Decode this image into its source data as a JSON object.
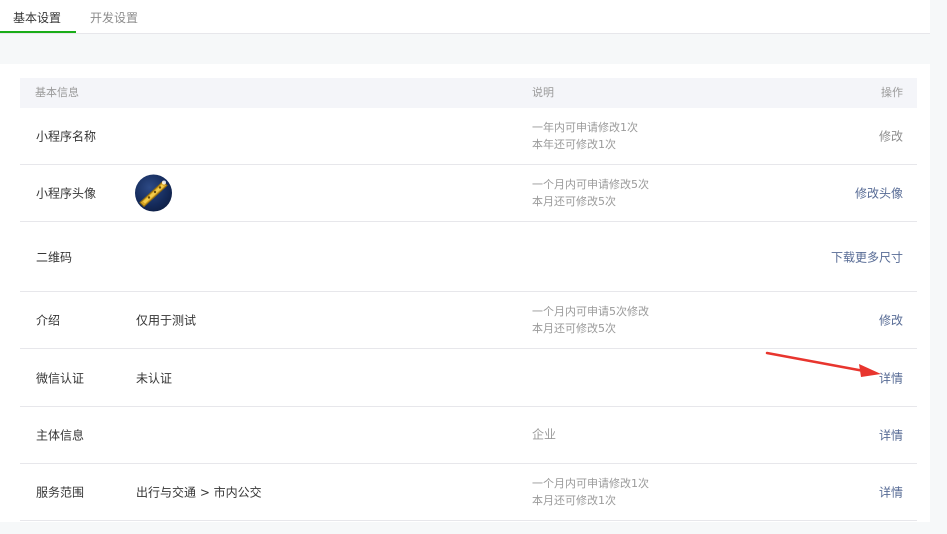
{
  "tabs": [
    {
      "label": "基本设置",
      "active": true
    },
    {
      "label": "开发设置",
      "active": false
    }
  ],
  "table": {
    "headers": {
      "info": "基本信息",
      "desc": "说明",
      "op": "操作"
    },
    "rows": [
      {
        "name": "小程序名称",
        "value": "",
        "desc": [
          "一年内可申请修改1次",
          "本年还可修改1次"
        ],
        "op": "修改"
      },
      {
        "name": "小程序头像",
        "value": "",
        "desc": [
          "一个月内可申请修改5次",
          "本月还可修改5次"
        ],
        "op": "修改头像"
      },
      {
        "name": "二维码",
        "value": "",
        "desc": [],
        "op": "下载更多尺寸"
      },
      {
        "name": "介绍",
        "value": "仅用于测试",
        "desc": [
          "一个月内可申请5次修改",
          "本月还可修改5次"
        ],
        "op": "修改"
      },
      {
        "name": "微信认证",
        "value": "未认证",
        "desc": [],
        "op": "详情"
      },
      {
        "name": "主体信息",
        "value": "",
        "desc": [
          "企业"
        ],
        "op": "详情"
      },
      {
        "name": "服务范围",
        "value": "出行与交通 > 市内公交",
        "desc": [
          "一个月内可申请修改1次",
          "本月还可修改1次"
        ],
        "op": "详情"
      }
    ]
  },
  "colors": {
    "accent": "#1aad19",
    "link": "#576b95",
    "arrow": "#e8352e"
  },
  "icons": {
    "avatar": "app-avatar-image",
    "arrow": "red-pointer-arrow"
  }
}
